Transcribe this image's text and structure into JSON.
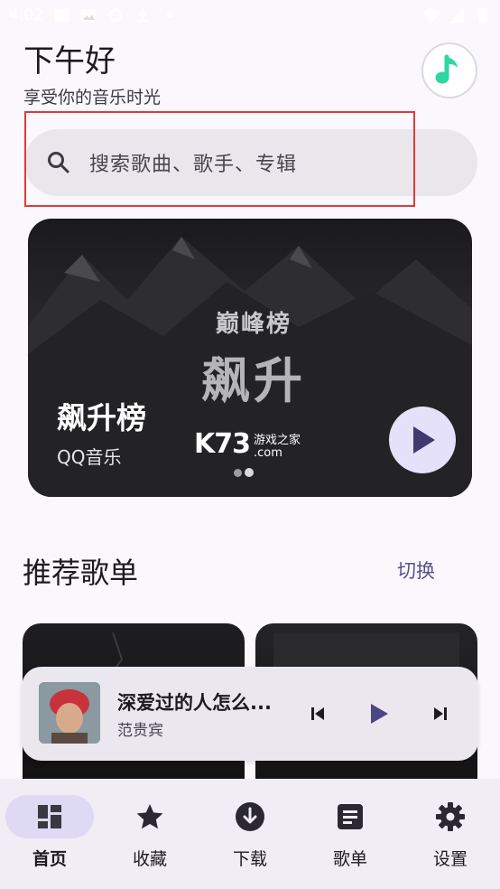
{
  "status_bar": {
    "time": "4:02"
  },
  "header": {
    "greeting": "下午好",
    "subtitle": "享受你的音乐时光"
  },
  "search": {
    "placeholder": "搜索歌曲、歌手、专辑"
  },
  "banner": {
    "title": "飙升榜",
    "source": "QQ音乐",
    "brand_top": "巅峰榜",
    "brand_main": "飙升",
    "dots_total": 2,
    "active_dot": 2
  },
  "watermark": {
    "logo": "K73",
    "text": "游戏之家",
    "domain": ".com"
  },
  "recommend": {
    "title": "推荐歌单",
    "switch_label": "切换"
  },
  "player": {
    "title": "深爱过的人怎么...",
    "artist": "范贵宾"
  },
  "nav": {
    "items": [
      {
        "label": "首页",
        "icon": "dashboard-icon",
        "active": true
      },
      {
        "label": "收藏",
        "icon": "star-icon",
        "active": false
      },
      {
        "label": "下载",
        "icon": "download-icon",
        "active": false
      },
      {
        "label": "歌单",
        "icon": "playlist-icon",
        "active": false
      },
      {
        "label": "设置",
        "icon": "gear-icon",
        "active": false
      }
    ]
  },
  "colors": {
    "accent": "#56528a",
    "nav_active_bg": "#dedaf4",
    "logo_green": "#2fd6a0",
    "highlight": "#e03a3a"
  }
}
